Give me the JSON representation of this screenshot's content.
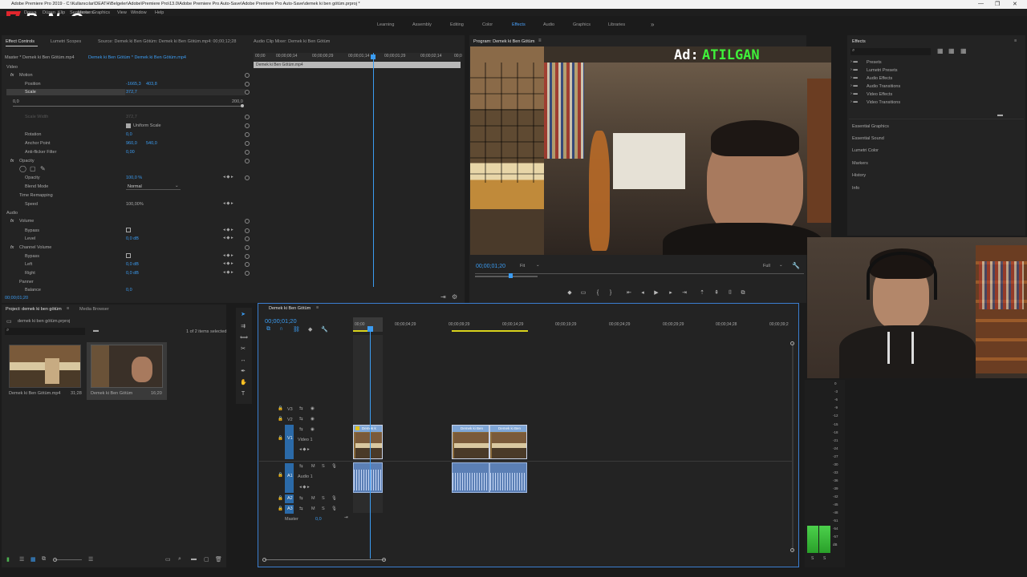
{
  "window": {
    "title": "Adobe Premiere Pro 2019 - C:\\Kullanıcılar\\DEATH\\Belgeler\\Adobe\\Premiere Pro\\13.0\\Adobe Premiere Pro Auto-Save\\Adobe Premiere Pro Auto-Save\\demek ki ben götüm.prproj *",
    "menus": [
      "Dosya",
      "Düzen",
      "Klip",
      "Sequence",
      "Markers",
      "Graphics",
      "View",
      "Window",
      "Help"
    ]
  },
  "watermark": "ByNoGame",
  "workspaces": [
    "Learning",
    "Assembly",
    "Editing",
    "Color",
    "Effects",
    "Audio",
    "Graphics",
    "Libraries"
  ],
  "workspace_active": "Effects",
  "workspace_more": "»",
  "effect_controls": {
    "tabs": [
      "Effect Controls",
      "Lumetri Scopes",
      "Source: Demek ki Ben Götüm: Demek ki Ben Götüm.mp4: 00;00;12;28",
      "Audio Clip Mixer: Demek ki Ben Götüm"
    ],
    "master": "Master * Demek ki Ben Götüm.mp4",
    "clip": "Demek ki Ben Götüm * Demek ki Ben Götüm.mp4",
    "ruler_ticks": [
      "00;00",
      "00;00;00;14",
      "00;00;00;29",
      "00;00;01;14",
      "00;00;01;29",
      "00;00;02;14",
      "00;0"
    ],
    "clip_bar": "Demek ki Ben Götüm.mp4",
    "rows": {
      "video": "Video",
      "motion": "Motion",
      "position_label": "Position",
      "position_x": "-1665,3",
      "position_y": "403,8",
      "scale_label": "Scale",
      "scale_value": "372,7",
      "scale_min": "0,0",
      "scale_max": "200,0",
      "scale_width": "Scale Width",
      "scale_width_value": "372,7",
      "uniform_scale": "Uniform Scale",
      "rotation": "Rotation",
      "rotation_value": "0,0",
      "anchor": "Anchor Point",
      "anchor_x": "960,0",
      "anchor_y": "540,0",
      "flicker": "Anti-flicker Filter",
      "flicker_value": "0,00",
      "opacity": "Opacity",
      "opacity_label": "Opacity",
      "opacity_value": "100,0 %",
      "blend_label": "Blend Mode",
      "blend_value": "Normal",
      "time_remap": "Time Remapping",
      "speed_label": "Speed",
      "speed_value": "100,00%",
      "audio": "Audio",
      "volume": "Volume",
      "bypass": "Bypass",
      "level": "Level",
      "level_value": "0,0 dB",
      "channel_volume": "Channel Volume",
      "bypass2": "Bypass",
      "left": "Left",
      "left_value": "0,0 dB",
      "right": "Right",
      "right_value": "0,0 dB",
      "panner": "Panner",
      "balance": "Balance",
      "balance_value": "0,0"
    },
    "footer_time": "00;00;01;20"
  },
  "program": {
    "title": "Program: Demek ki Ben Götüm",
    "overlay_prefix": "Ad:",
    "overlay_name": "ATILGAN",
    "timecode": "00;00;01;20",
    "fit": "Fit",
    "quality": "Full"
  },
  "effects_panel": {
    "title": "Effects",
    "folders": [
      "Presets",
      "Lumetri Presets",
      "Audio Effects",
      "Audio Transitions",
      "Video Effects",
      "Video Transitions"
    ],
    "sections": [
      "Essential Graphics",
      "Essential Sound",
      "Lumetri Color",
      "Markers",
      "History",
      "Info"
    ]
  },
  "project": {
    "tabs": [
      "Project: demek ki ben götüm",
      "Media Browser"
    ],
    "file": "demek ki ben götüm.prproj",
    "items_count": "1 of 2 items selected",
    "items": [
      {
        "name": "Demek ki Ben Götüm.mp4",
        "duration": "31;28"
      },
      {
        "name": "Demek ki Ben Götüm",
        "duration": "16;20"
      }
    ]
  },
  "timeline": {
    "title": "Demek ki Ben Götüm",
    "timecode": "00;00;01;20",
    "ruler": [
      "00;00",
      "00;00;04;29",
      "00;00;09;29",
      "00;00;14;29",
      "00;00;19;29",
      "00;00;24;29",
      "00;00;29;29",
      "00;00;34;28",
      "00;00;39;2"
    ],
    "tracks": [
      "V3",
      "V2",
      "V1",
      "A1",
      "A2",
      "A3"
    ],
    "video_track_name": "Video 1",
    "audio_track_name": "Audio 1",
    "master_label": "Master",
    "master_value": "0,0",
    "clips": [
      "Demek k",
      "Demek ki Ben",
      "Demek ki Ben"
    ]
  },
  "meter_scale": [
    "0",
    "-3",
    "-6",
    "-9",
    "-12",
    "-15",
    "-18",
    "-21",
    "-24",
    "-27",
    "-30",
    "-33",
    "-36",
    "-39",
    "-42",
    "-45",
    "-48",
    "-51",
    "-54",
    "-57",
    "dB"
  ],
  "meter_footer": [
    "S",
    "S"
  ],
  "window_controls": [
    "—",
    "❐",
    "✕"
  ]
}
